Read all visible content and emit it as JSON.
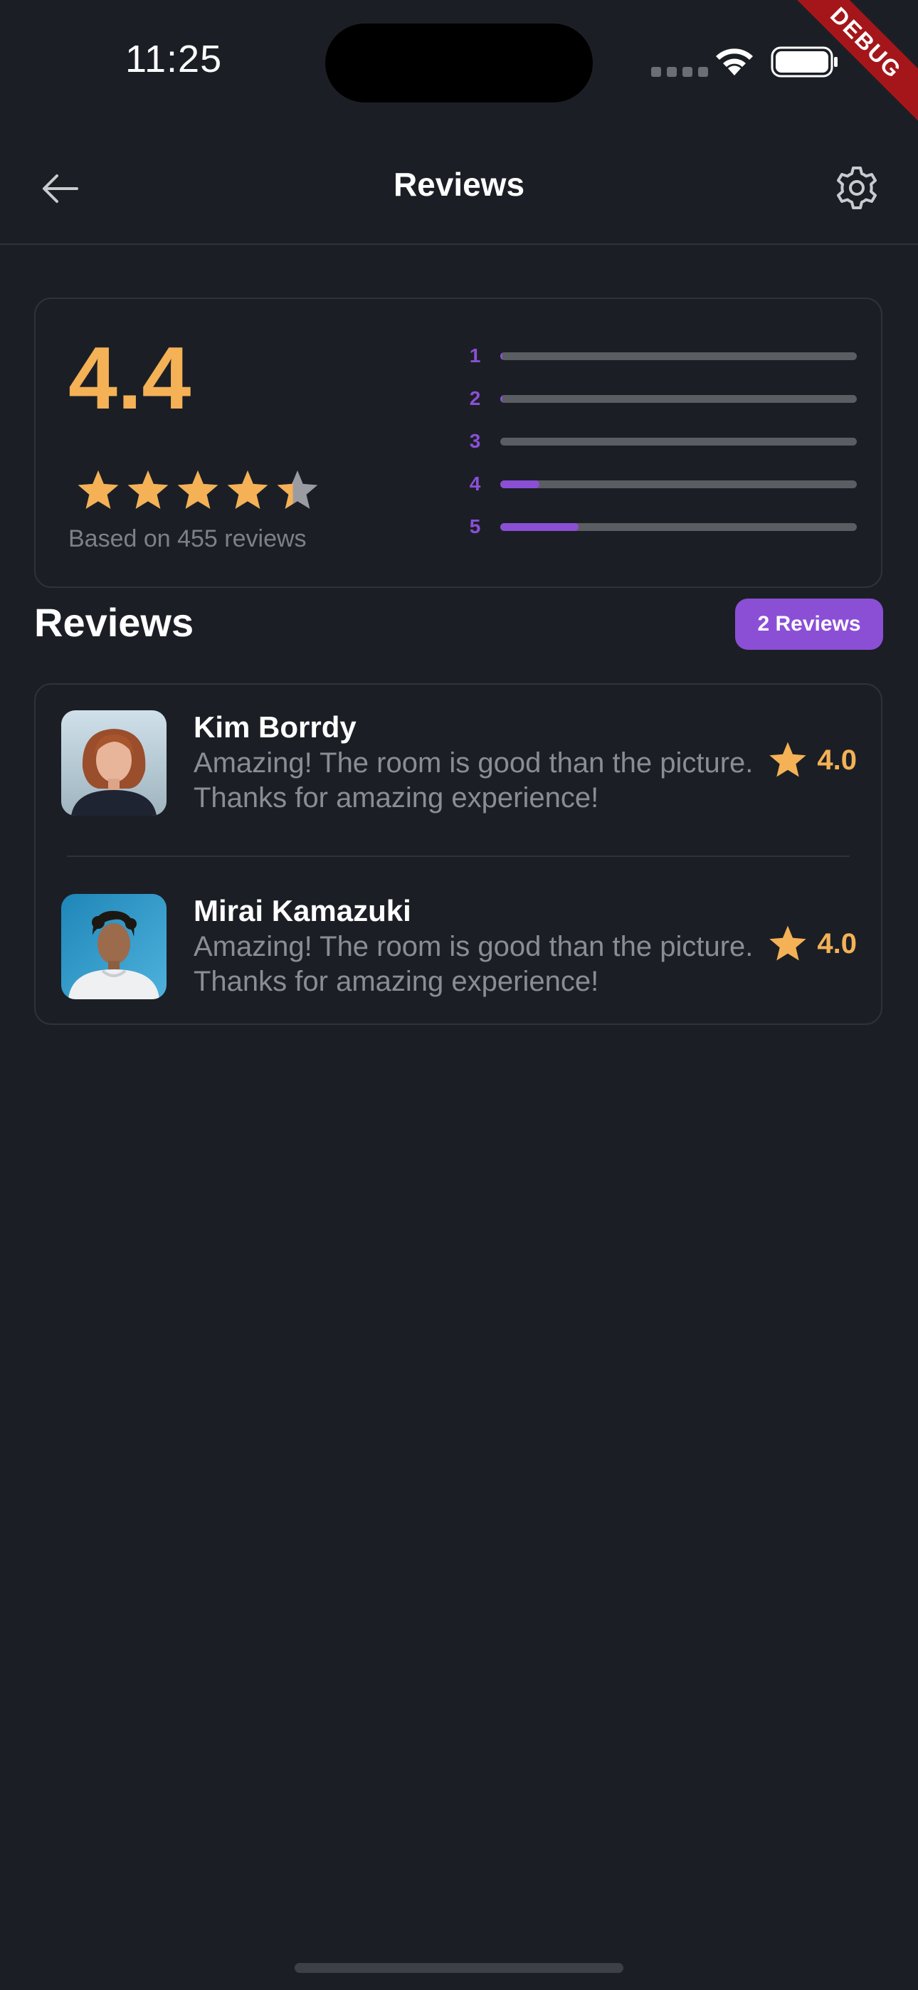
{
  "status_bar": {
    "time": "11:25",
    "wifi_icon": "wifi-icon",
    "battery_icon": "battery-full-icon",
    "debug_banner": "DEBUG"
  },
  "app_bar": {
    "title": "Reviews",
    "back_icon": "arrow-left-icon",
    "settings_icon": "gear-icon"
  },
  "summary": {
    "average": "4.4",
    "average_value": 4.4,
    "stars_max": 5,
    "based_on": "Based on 455 reviews",
    "distribution": [
      {
        "label": "1",
        "fraction": 0.005
      },
      {
        "label": "2",
        "fraction": 0.005
      },
      {
        "label": "3",
        "fraction": 0.0
      },
      {
        "label": "4",
        "fraction": 0.11
      },
      {
        "label": "5",
        "fraction": 0.22
      }
    ],
    "colors": {
      "rating": "#f4b156",
      "accent": "#8b4fd6",
      "track": "#5a5d62",
      "star_empty": "#9a9ca1"
    }
  },
  "reviews_section": {
    "title": "Reviews",
    "count_badge": "2 Reviews",
    "items": [
      {
        "name": "Kim Borrdy",
        "text": "Amazing! The room is good than the picture. Thanks for amazing experience!",
        "rating": "4.0",
        "star_icon": "star-icon"
      },
      {
        "name": "Mirai Kamazuki",
        "text": "Amazing! The room is good than the picture. Thanks for amazing experience!",
        "rating": "4.0",
        "star_icon": "star-icon"
      }
    ]
  }
}
